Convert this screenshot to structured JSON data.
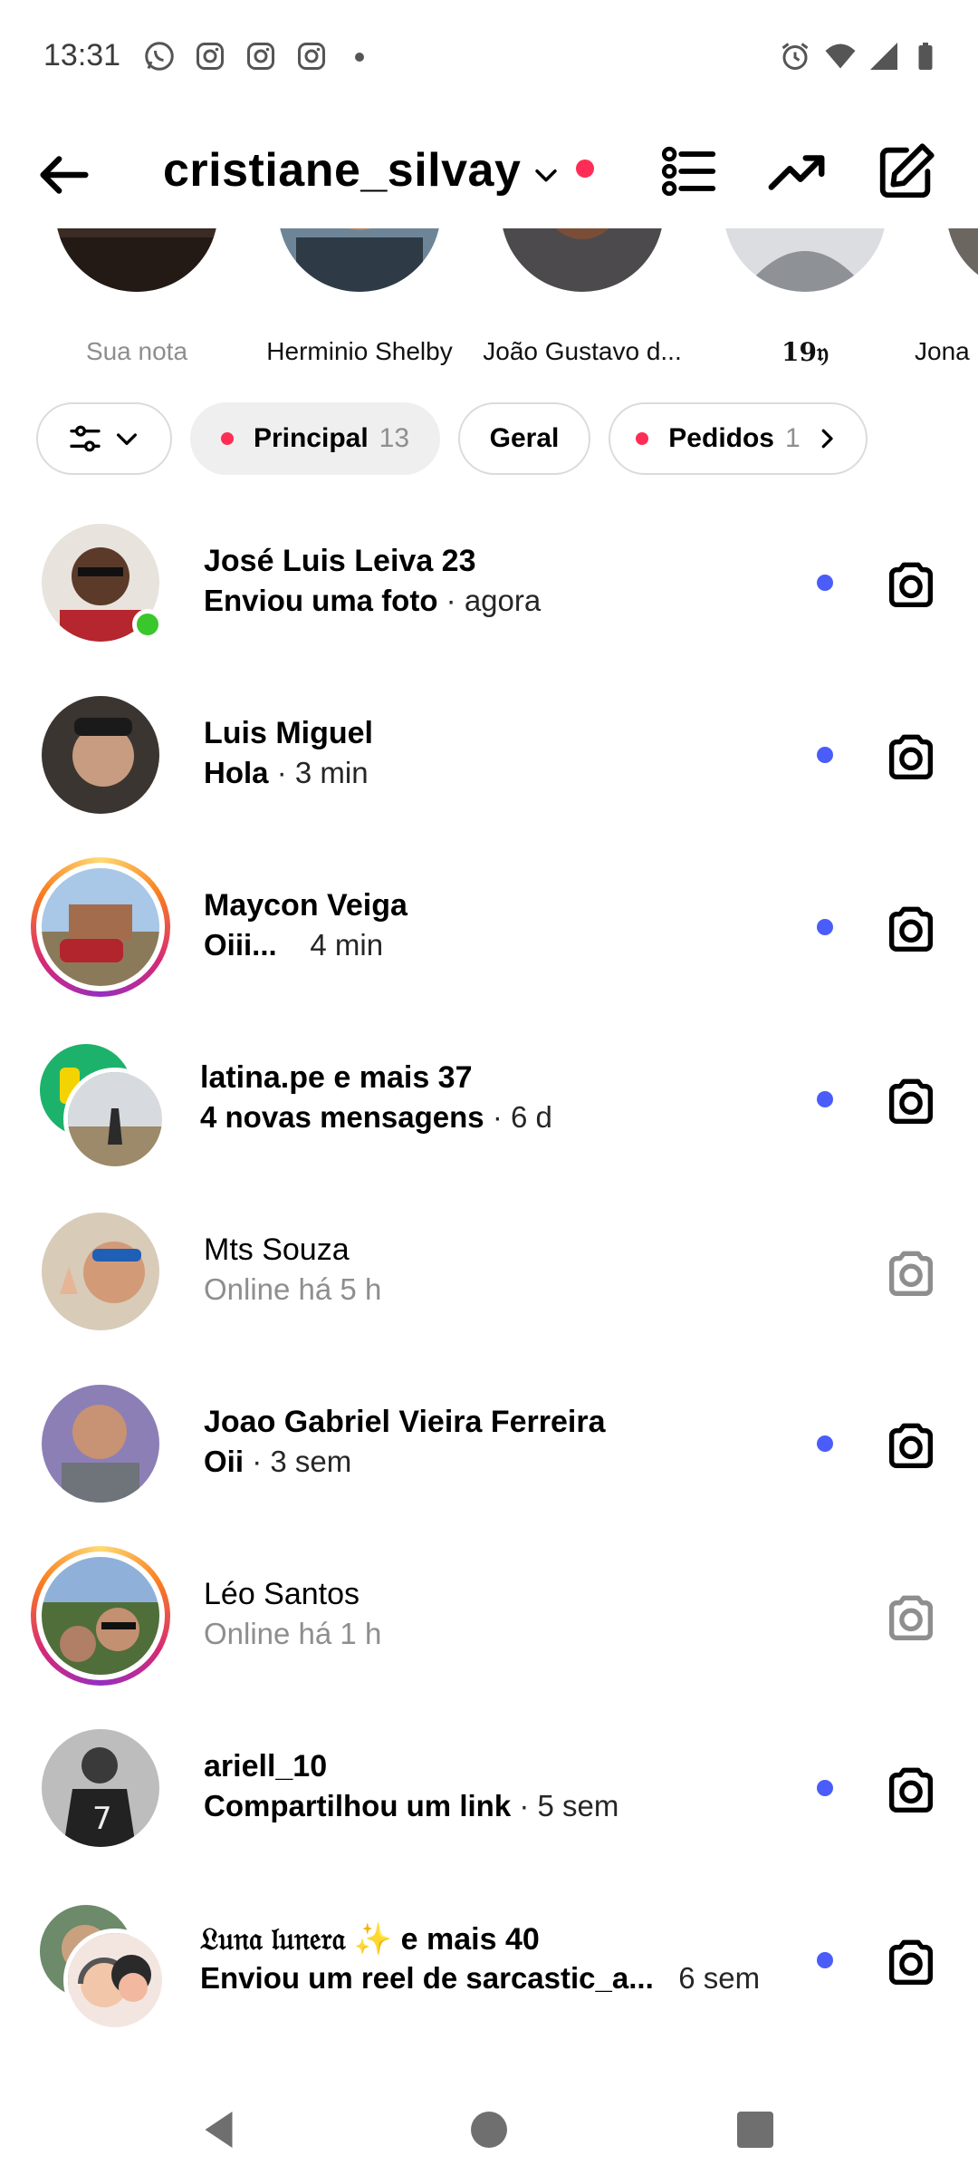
{
  "status_bar": {
    "time": "13:31",
    "left_icons": [
      "whatsapp-icon",
      "instagram-icon",
      "instagram-icon",
      "instagram-icon",
      "more-dot-icon"
    ],
    "right_icons": [
      "alarm-icon",
      "wifi-icon",
      "signal-icon",
      "battery-icon"
    ]
  },
  "header": {
    "username": "cristiane_silvay",
    "icons": [
      "back-arrow-icon",
      "chevron-down-icon",
      "list-icon",
      "trending-icon",
      "compose-icon"
    ],
    "accent": "#ff2d55"
  },
  "notes": [
    {
      "label": "Sua nota"
    },
    {
      "label": "Herminio Shelby"
    },
    {
      "label": "João Gustavo d..."
    },
    {
      "label": "𝟏𝟗𝔶"
    },
    {
      "label": "Jona"
    }
  ],
  "filters": {
    "principal": {
      "label": "Principal",
      "count": "13"
    },
    "geral": {
      "label": "Geral"
    },
    "pedidos": {
      "label": "Pedidos",
      "count": "1"
    }
  },
  "conversations": [
    {
      "name": "José Luis Leiva 23",
      "message": "Enviou uma foto",
      "time": "· agora",
      "unread": true
    },
    {
      "name": "Luis Miguel",
      "message": "Hola",
      "time": "· 3 min",
      "unread": true
    },
    {
      "name": "Maycon Veiga",
      "message": "Oiii...",
      "time": "4 min",
      "unread": true
    },
    {
      "name": "latina.pe e mais 37",
      "message": "4 novas mensagens",
      "time": "· 6 d",
      "unread": true
    },
    {
      "name": "Mts Souza",
      "message": "Online há 5 h",
      "time": "",
      "unread": false
    },
    {
      "name": "Joao Gabriel Vieira Ferreira",
      "message": "Oii",
      "time": "· 3 sem",
      "unread": true
    },
    {
      "name": "Léo Santos",
      "message": "Online há 1 h",
      "time": "",
      "unread": false
    },
    {
      "name": "ariell_10",
      "message": "Compartilhou um link",
      "time": "· 5 sem",
      "unread": true
    },
    {
      "name": "𝔏𝔲𝔫𝔞 𝔩𝔲𝔫𝔢𝔯𝔞 ✨ e mais 40",
      "message": "Enviou um reel de sarcastic_a...",
      "time": "6 sem",
      "unread": true
    }
  ],
  "colors": {
    "unread_dot": "#4a5df9",
    "online": "#3ac72b",
    "chip_border": "#dbdbdb",
    "muted": "#8e8e8e"
  },
  "navbar": {
    "icons": [
      "nav-back-icon",
      "nav-home-icon",
      "nav-recents-icon"
    ]
  }
}
